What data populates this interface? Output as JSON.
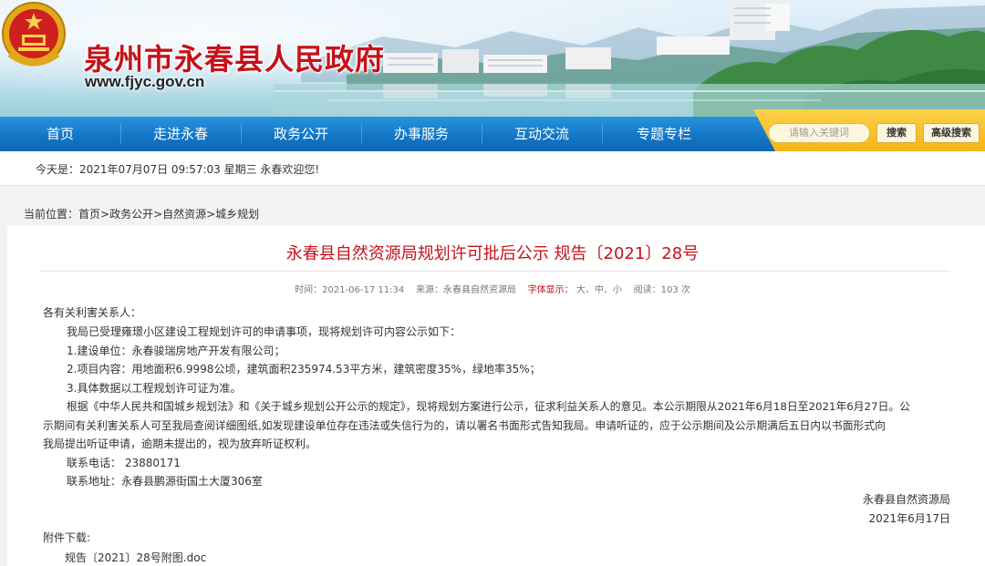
{
  "site": {
    "title": "泉州市永春县人民政府",
    "url": "www.fjyc.gov.cn"
  },
  "nav": {
    "items": [
      "首页",
      "走进永春",
      "政务公开",
      "办事服务",
      "互动交流",
      "专题专栏"
    ],
    "search_placeholder": "请输入关键词",
    "search_button": "搜索",
    "advanced_search": "高级搜索"
  },
  "dateline": {
    "text": "今天是：2021年07月07日 09:57:03 星期三  永春欢迎您!"
  },
  "breadcrumb": {
    "label": "当前位置：",
    "path": "首页>政务公开>自然资源>城乡规划"
  },
  "article": {
    "title": "永春县自然资源局规划许可批后公示 规告〔2021〕28号",
    "meta_time": "时间：2021-06-17 11:34",
    "meta_source": "来源：永春县自然资源局",
    "meta_font_label": "字体显示：",
    "meta_font_sizes": "大、中、小",
    "meta_views": "阅读：103 次",
    "salutation": "各有关利害关系人：",
    "paragraphs": [
      "我局已受理雍璟小区建设工程规划许可的申请事项，现将规划许可内容公示如下：",
      "1.建设单位：永春骏瑞房地产开发有限公司；",
      "2.项目内容：用地面积6.9998公顷，建筑面积235974.53平方米，建筑密度35%，绿地率35%；",
      "3.具体数据以工程规划许可证为准。",
      "根据《中华人民共和国城乡规划法》和《关于城乡规划公开公示的规定》，现将规划方案进行公示，征求利益关系人的意见。本公示期限从2021年6月18日至2021年6月27日。公",
      "示期间有关利害关系人可至我局查阅详细图纸,如发现建设单位存在违法或失信行为的，请以署名书面形式告知我局。申请听证的，应于公示期间及公示期满后五日内以书面形式向",
      "我局提出听证申请，逾期未提出的，视为放弃听证权利。",
      "联系电话： 23880171",
      "联系地址：永春县鹏源街国土大厦306室"
    ],
    "signature": "永春县自然资源局",
    "date": "2021年6月17日",
    "attachment_label": "附件下载:",
    "attachment_file": "规告〔2021〕28号附图.doc"
  }
}
